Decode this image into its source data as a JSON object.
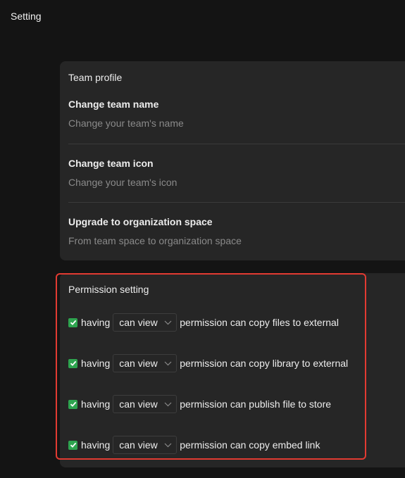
{
  "header": {
    "title": "Setting"
  },
  "team_profile": {
    "title": "Team profile",
    "items": [
      {
        "title": "Change team name",
        "description": "Change your team's name"
      },
      {
        "title": "Change team icon",
        "description": "Change your team's icon"
      },
      {
        "title": "Upgrade to organization space",
        "description": "From team space to organization space"
      }
    ]
  },
  "permission_setting": {
    "title": "Permission setting",
    "rows": [
      {
        "checked": true,
        "prefix": "having",
        "select_value": "can view",
        "suffix": "permission can copy files to external"
      },
      {
        "checked": true,
        "prefix": "having",
        "select_value": "can view",
        "suffix": "permission can copy library to external"
      },
      {
        "checked": true,
        "prefix": "having",
        "select_value": "can view",
        "suffix": "permission can publish file to store"
      },
      {
        "checked": true,
        "prefix": "having",
        "select_value": "can view",
        "suffix": "permission can copy embed link"
      }
    ]
  },
  "colors": {
    "background": "#141414",
    "card": "#262626",
    "checkbox": "#2ea44f",
    "highlight": "#e23b32"
  },
  "icons": {
    "checkbox": "checkmark-icon",
    "select": "chevron-down-icon"
  }
}
